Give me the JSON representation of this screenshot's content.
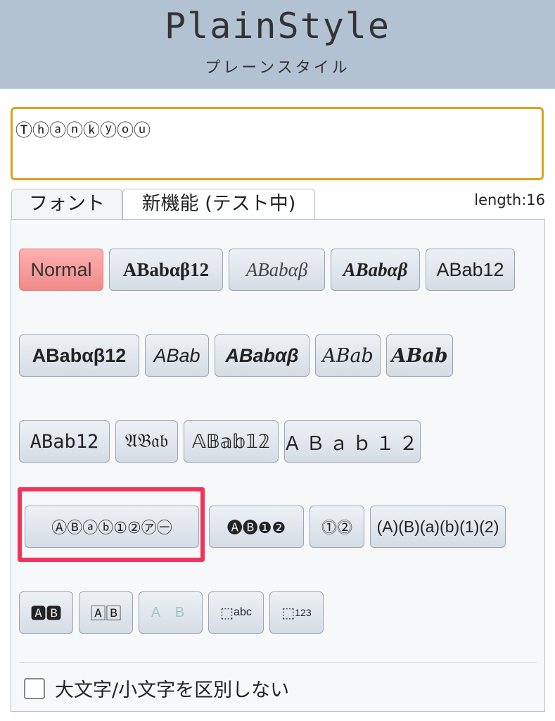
{
  "header": {
    "logo_text": "PlainStyle",
    "logo_subtext": "プレーンスタイル"
  },
  "input": {
    "value": "Ⓣⓗⓐⓝⓚⓨⓞⓤ"
  },
  "tabs": {
    "font_label": "フォント",
    "new_label": "新機能 (テスト中)"
  },
  "length_text": "length:16",
  "font_buttons": {
    "normal": "Normal",
    "serif_bold": "ABabαβ12",
    "serif_italic": "ABabαβ",
    "serif_bold_italic": "ABabαβ",
    "sans": "ABab12",
    "sans_bold": "ABabαβ12",
    "sans_italic": "ABab",
    "sans_bold_italic": "ABabαβ",
    "script": "ABab",
    "script_bold": "ABab",
    "monospace": "ABab12",
    "fraktur": "𝔄𝔅𝔞𝔟",
    "double_struck": "𝔸𝔹𝕒𝕓𝟙𝟚",
    "fullwidth": "ＡＢａｂ１２",
    "circled": "ⒶⒷⓐⓑ①②㋐㊀",
    "negative_circled": "🅐🅑❶❷",
    "double_circled": "⓵⓶",
    "parenthesized": "⒜⒝⒜⒝⑴⑵",
    "parenthesized_display": "(A)(B)(a)(b)(1)(2)",
    "negative_squared": "🅰🅱",
    "squared": "🄰🄱",
    "outlined": "A B",
    "superscript_icon": "⬚",
    "superscript_text": "abc",
    "subscript_icon": "⬚",
    "subscript_text": "123"
  },
  "options": {
    "case_insensitive_label": "大文字/小文字を区別しない"
  },
  "colors": {
    "header_bg": "#b3c2d3",
    "input_border": "#e0a020",
    "active_button": "#f5a0a0",
    "highlight_border": "#f2335a"
  }
}
